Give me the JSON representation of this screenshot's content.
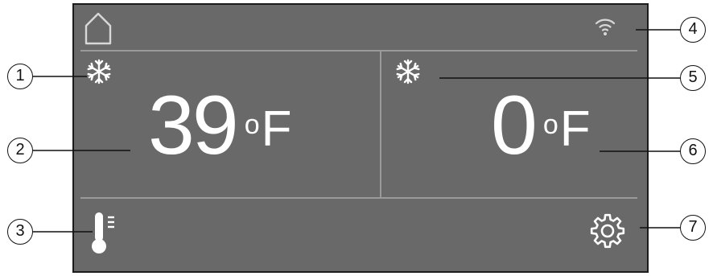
{
  "display": {
    "fridge": {
      "temperature": "39",
      "degree_symbol": "o",
      "unit": "F"
    },
    "freezer": {
      "temperature": "0",
      "degree_symbol": "o",
      "unit": "F"
    }
  },
  "icons": {
    "home": "home-icon",
    "wifi": "wifi-icon",
    "fridge_mode": "snowflake-icon",
    "freezer_mode": "snowflake-icon",
    "thermometer": "thermometer-icon",
    "settings": "gear-icon"
  },
  "callouts": [
    "1",
    "2",
    "3",
    "4",
    "5",
    "6",
    "7"
  ],
  "colors": {
    "panel": "#696969",
    "divider": "#9a9a9a",
    "foreground": "#ffffff"
  }
}
